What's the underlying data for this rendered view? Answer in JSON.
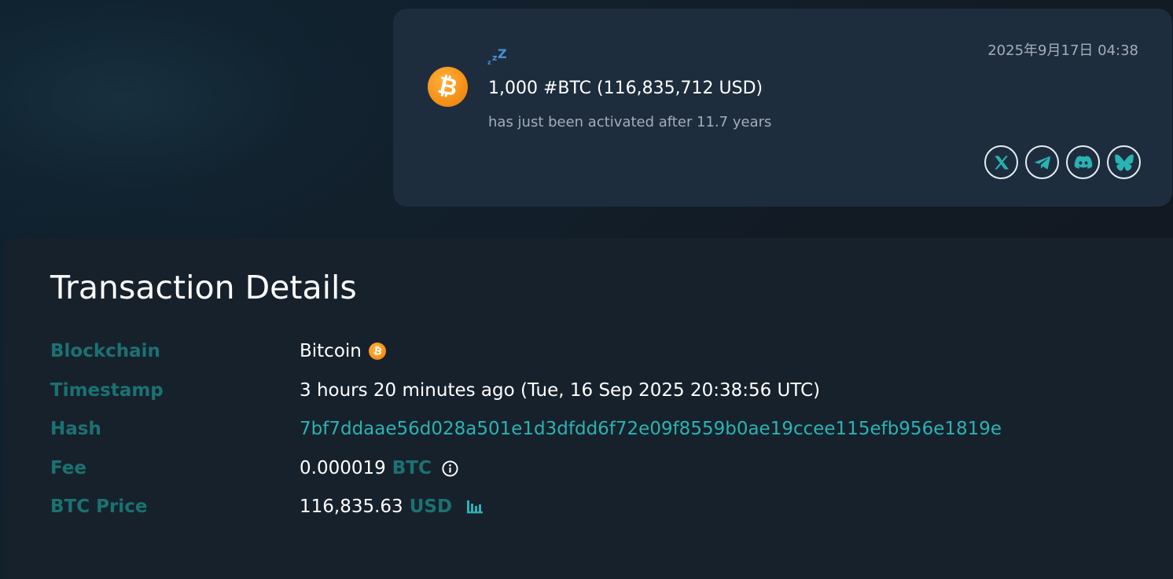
{
  "alert": {
    "amount_text": "1,000 #BTC (116,835,712 USD)",
    "subtitle": "has just been activated after 11.7 years",
    "date": "2025年9月17日 04:38",
    "coin_symbol": "₿",
    "icons": {
      "coin": "bitcoin-icon",
      "status": "sleep-zzz-icon",
      "share": [
        "x-icon",
        "telegram-icon",
        "discord-icon",
        "bluesky-icon"
      ]
    }
  },
  "details": {
    "title": "Transaction Details",
    "rows": {
      "blockchain": {
        "label": "Blockchain",
        "value": "Bitcoin"
      },
      "timestamp": {
        "label": "Timestamp",
        "value": "3 hours 20 minutes ago (Tue, 16 Sep 2025 20:38:56 UTC)"
      },
      "hash": {
        "label": "Hash",
        "value": "7bf7ddaae56d028a501e1d3dfdd6f72e09f8559b0ae19ccee115efb956e1819e"
      },
      "fee": {
        "label": "Fee",
        "value": "0.000019",
        "unit": "BTC"
      },
      "price": {
        "label": "BTC Price",
        "value": "116,835.63",
        "unit": "USD"
      }
    }
  },
  "colors": {
    "bitcoin_orange": "#f7931a",
    "label_teal": "#1b7272",
    "link_teal": "#2ab3b3",
    "card_bg": "#1e2d3d",
    "panel_bg": "#17212c"
  }
}
